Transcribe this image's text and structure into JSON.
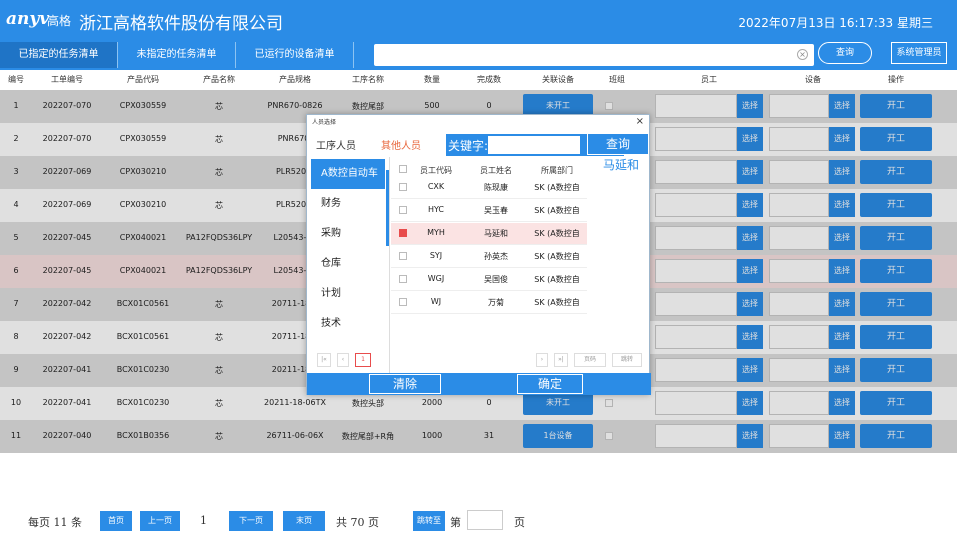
{
  "header": {
    "logo": "anyv",
    "logo_cn": "高格",
    "company": "浙江高格软件股份有限公司",
    "datetime": "2022年07月13日 16:17:33  星期三"
  },
  "tabs": [
    {
      "label": "已指定的任务清单"
    },
    {
      "label": "未指定的任务清单"
    },
    {
      "label": "已运行的设备清单"
    }
  ],
  "toolbar": {
    "search_value": "",
    "query_label": "查询",
    "admin_label": "系统管理员"
  },
  "columns": [
    "编号",
    "工单编号",
    "产品代码",
    "产品名称",
    "产品规格",
    "工序名称",
    "数量",
    "完成数",
    "关联设备",
    "班组",
    "员工",
    "设备",
    "操作"
  ],
  "rows": [
    {
      "no": "1",
      "order": "202207-070",
      "code": "CPX030559",
      "name": "芯",
      "spec": "PNR670-0826",
      "proc": "数控尾部",
      "qty": "500",
      "done": "0",
      "assoc": "未开工"
    },
    {
      "no": "2",
      "order": "202207-070",
      "code": "CPX030559",
      "name": "芯",
      "spec": "PNR670-",
      "proc": "",
      "qty": "",
      "done": "",
      "assoc": ""
    },
    {
      "no": "3",
      "order": "202207-069",
      "code": "CPX030210",
      "name": "芯",
      "spec": "PLR520-1",
      "proc": "",
      "qty": "",
      "done": "",
      "assoc": ""
    },
    {
      "no": "4",
      "order": "202207-069",
      "code": "CPX030210",
      "name": "芯",
      "spec": "PLR520-1",
      "proc": "",
      "qty": "",
      "done": "",
      "assoc": ""
    },
    {
      "no": "5",
      "order": "202207-045",
      "code": "CPX040021",
      "name": "PA12FQDS36LPY",
      "spec": "L20543-36",
      "proc": "",
      "qty": "",
      "done": "",
      "assoc": ""
    },
    {
      "no": "6",
      "order": "202207-045",
      "code": "CPX040021",
      "name": "PA12FQDS36LPY",
      "spec": "L20543-36",
      "proc": "",
      "qty": "",
      "done": "",
      "assoc": ""
    },
    {
      "no": "7",
      "order": "202207-042",
      "code": "BCX01C0561",
      "name": "芯",
      "spec": "20711-18-0",
      "proc": "",
      "qty": "",
      "done": "",
      "assoc": ""
    },
    {
      "no": "8",
      "order": "202207-042",
      "code": "BCX01C0561",
      "name": "芯",
      "spec": "20711-18-0",
      "proc": "",
      "qty": "",
      "done": "",
      "assoc": ""
    },
    {
      "no": "9",
      "order": "202207-041",
      "code": "BCX01C0230",
      "name": "芯",
      "spec": "20211-18-0",
      "proc": "",
      "qty": "",
      "done": "",
      "assoc": ""
    },
    {
      "no": "10",
      "order": "202207-041",
      "code": "BCX01C0230",
      "name": "芯",
      "spec": "20211-18-06TX",
      "proc": "数控头部",
      "qty": "2000",
      "done": "0",
      "assoc": "未开工"
    },
    {
      "no": "11",
      "order": "202207-040",
      "code": "BCX01B0356",
      "name": "芯",
      "spec": "26711-06-06X",
      "proc": "数控尾部+R角",
      "qty": "1000",
      "done": "31",
      "assoc": "1台设备"
    }
  ],
  "row_labels": {
    "pick": "选择",
    "start": "开工"
  },
  "pager": {
    "per_page": "每页 11 条",
    "first": "首页",
    "prev": "上一页",
    "current": "1",
    "next": "下一页",
    "last": "末页",
    "total": "共 70  页",
    "jump": "跳转至",
    "di": "第",
    "ye": "页"
  },
  "modal": {
    "title": "人员选择",
    "close": "×",
    "tab_process": "工序人员",
    "tab_other": "其他人员",
    "keyword_label": "关键字:",
    "keyword_value": "",
    "query": "查询",
    "selected": "马延和",
    "departments": [
      "A数控自动车",
      "财务",
      "采购",
      "仓库",
      "计划",
      "技术"
    ],
    "headers": [
      "员工代码",
      "员工姓名",
      "所属部门"
    ],
    "employees": [
      {
        "code": "CXK",
        "name": "陈现康",
        "dept": "SK (A数控自"
      },
      {
        "code": "HYC",
        "name": "吴玉春",
        "dept": "SK (A数控自"
      },
      {
        "code": "MYH",
        "name": "马延和",
        "dept": "SK (A数控自",
        "checked": true
      },
      {
        "code": "SYJ",
        "name": "孙英杰",
        "dept": "SK (A数控自"
      },
      {
        "code": "WGJ",
        "name": "吴国俊",
        "dept": "SK (A数控自"
      },
      {
        "code": "WJ",
        "name": "万菊",
        "dept": "SK (A数控自"
      }
    ],
    "pager": {
      "first": "|«",
      "prev": "‹",
      "page": "1",
      "next": "›",
      "last": "»|",
      "goto": "页码",
      "jump": "跳转"
    },
    "clear": "清除",
    "confirm": "确定"
  },
  "colors": {
    "accent": "#2b8ce6",
    "row_alt": "#e0e0e0",
    "row_highlight": "#f8e1e1"
  }
}
